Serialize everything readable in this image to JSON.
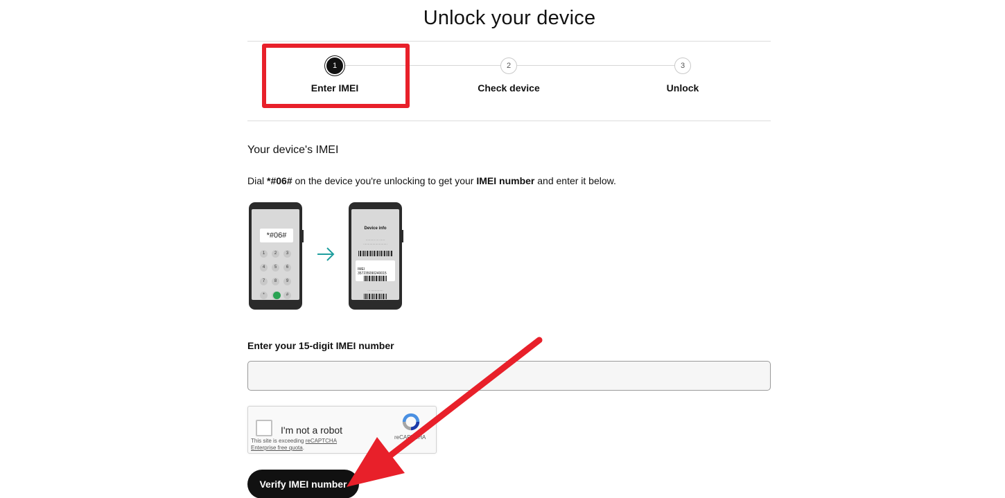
{
  "page": {
    "title": "Unlock your device"
  },
  "stepper": {
    "steps": [
      {
        "number": "1",
        "label": "Enter IMEI"
      },
      {
        "number": "2",
        "label": "Check device"
      },
      {
        "number": "3",
        "label": "Unlock"
      }
    ]
  },
  "section": {
    "title": "Your device's IMEI",
    "instructions": {
      "pre": "Dial ",
      "code": "*#06#",
      "mid": " on the device you're unlocking to get your ",
      "strong": "IMEI number",
      "post": " and enter it below."
    }
  },
  "illustration": {
    "dial_text": "*#06#",
    "info_title": "Device info",
    "imei_card_text": "IMEI 357235090240015",
    "keypad_keys": [
      "1",
      "2",
      "3",
      "4",
      "5",
      "6",
      "7",
      "8",
      "9",
      "*",
      "0",
      "#"
    ]
  },
  "form": {
    "imei_label": "Enter your 15-digit IMEI number",
    "imei_value": "",
    "imei_placeholder": ""
  },
  "recaptcha": {
    "label": "I'm not a robot",
    "notice_pre": "This site is exceeding ",
    "notice_link1": "reCAPTCHA",
    "notice_link2": "Enterprise free quota",
    "notice_post": ".",
    "brand": "reCAPTCHA"
  },
  "actions": {
    "verify_label": "Verify IMEI number"
  },
  "colors": {
    "annotation": "#e8202a",
    "accent": "#1e9e9e",
    "button": "#111111"
  },
  "icons": {
    "arrow": "arrow-right-icon",
    "recaptcha": "recaptcha-logo-icon"
  }
}
